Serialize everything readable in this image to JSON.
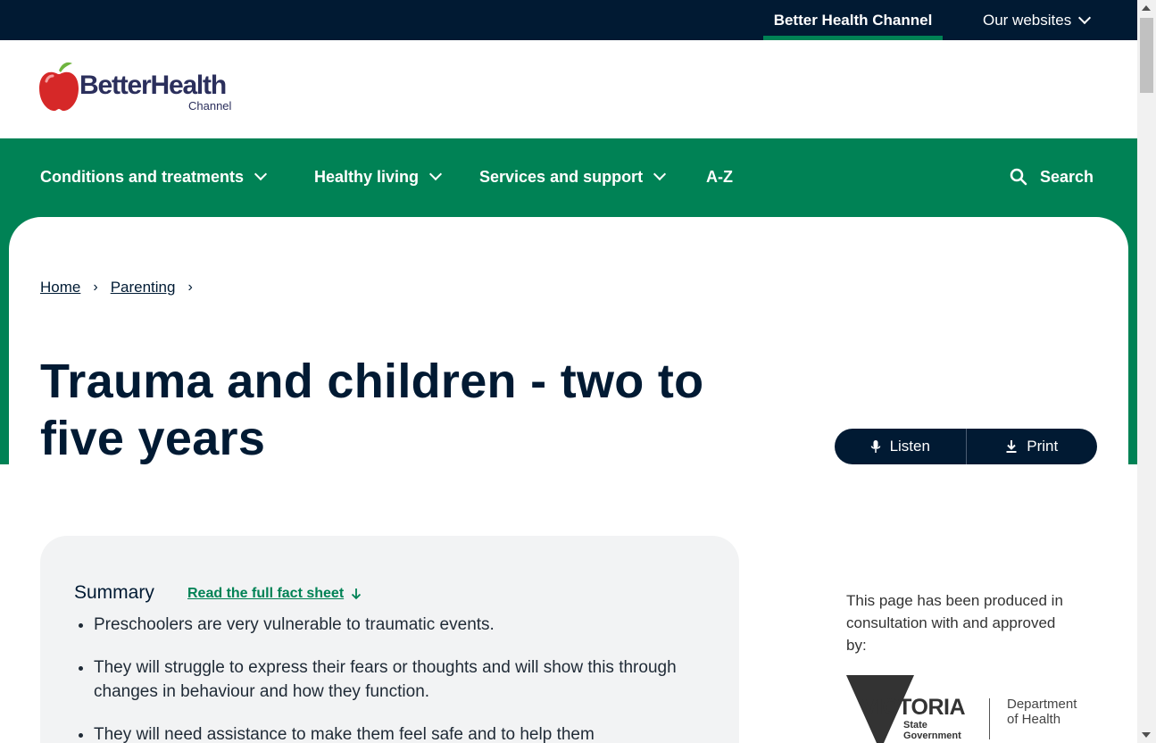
{
  "topbar": {
    "site_label": "Better Health Channel",
    "websites_label": "Our websites"
  },
  "logo": {
    "word": "BetterHealth",
    "sub": "Channel"
  },
  "nav": {
    "items": [
      {
        "label": "Conditions and treatments"
      },
      {
        "label": "Healthy living"
      },
      {
        "label": "Services and support"
      },
      {
        "label": "A-Z"
      }
    ],
    "search_label": "Search"
  },
  "breadcrumb": {
    "home": "Home",
    "parenting": "Parenting",
    "sep": "›"
  },
  "page": {
    "title": "Trauma and children - two to five years"
  },
  "actions": {
    "listen": "Listen",
    "print": "Print"
  },
  "summary": {
    "heading": "Summary",
    "fact_link": "Read the full fact sheet",
    "points": [
      "Preschoolers are very vulnerable to traumatic events.",
      "They will struggle to express their fears or thoughts and will show this through changes in behaviour and how they function.",
      "They will need assistance to make them feel safe and to help them"
    ]
  },
  "approval": {
    "text": "This page has been produced in consultation with and approved by:",
    "vic_word": "VICTORIA",
    "vic_state": "State\nGovernment",
    "dept": "Department\nof Health"
  },
  "colors": {
    "navy": "#011a33",
    "green": "#008255",
    "summary_bg": "#f2f3f4"
  }
}
